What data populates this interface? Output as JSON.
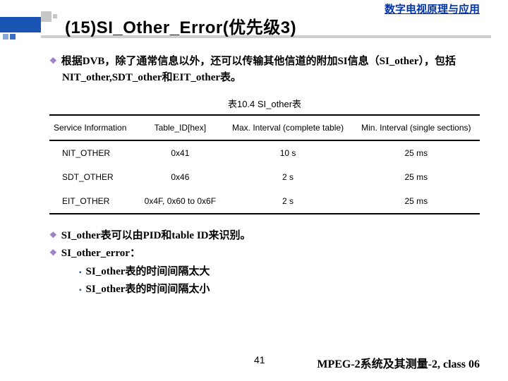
{
  "header": {
    "course": "数字电视原理与应用"
  },
  "title": "(15)SI_Other_Error(优先级3)",
  "bullet_top": "根据DVB，除了通常信息以外，还可以传输其他信道的附加SI信息（SI_other），包括NIT_other,SDT_other和EIT_other表。",
  "table_caption": "表10.4 SI_other表",
  "table": {
    "headers": [
      "Service Information",
      "Table_ID[hex]",
      "Max. Interval (complete table)",
      "Min. Interval (single sections)"
    ],
    "rows": [
      {
        "c0": "NIT_OTHER",
        "c1": "0x41",
        "c2": "10 s",
        "c3": "25 ms"
      },
      {
        "c0": "SDT_OTHER",
        "c1": "0x46",
        "c2": "2 s",
        "c3": "25 ms"
      },
      {
        "c0": "EIT_OTHER",
        "c1": "0x4F, 0x60 to 0x6F",
        "c2": "2 s",
        "c3": "25 ms"
      }
    ]
  },
  "bullets2": {
    "a": "SI_other表可以由PID和table ID来识别。",
    "b": "SI_other_error：",
    "b1": "SI_other表的时间间隔太大",
    "b2": "SI_other表的时间间隔太小"
  },
  "footer": {
    "page": "41",
    "right": "MPEG-2系统及其测量-2, class 06"
  }
}
